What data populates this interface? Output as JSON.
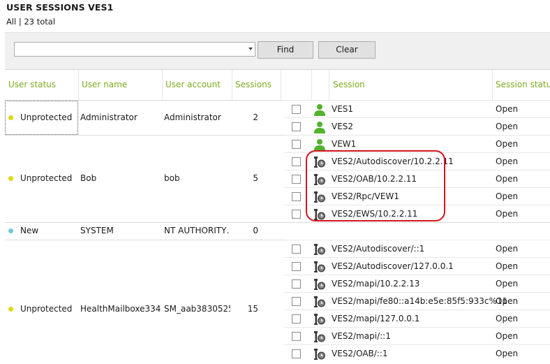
{
  "header": {
    "title": "USER SESSIONS  VES1",
    "subtitle": "All | 23 total"
  },
  "filter": {
    "value": "",
    "placeholder": "",
    "find_label": "Find",
    "clear_label": "Clear"
  },
  "columns": {
    "user_status": "User status",
    "user_name": "User name",
    "user_account": "User account",
    "sessions": "Sessions",
    "session": "Session",
    "session_status": "Session status"
  },
  "colors": {
    "header_green": "#7cab1f",
    "unprotected": "#e0d90f",
    "new": "#6ecbd3",
    "highlight": "#d4141f"
  },
  "users": [
    {
      "status": "Unprotected",
      "status_color": "#e0d90f",
      "name": "Administrator",
      "account": "Administrator",
      "sessions": "2"
    },
    {
      "status": "Unprotected",
      "status_color": "#e0d90f",
      "name": "Bob",
      "account": "bob",
      "sessions": "5"
    },
    {
      "status": "New",
      "status_color": "#6ecbd3",
      "name": "SYSTEM",
      "account": "NT AUTHORITY…",
      "sessions": "0"
    },
    {
      "status": "Unprotected",
      "status_color": "#e0d90f",
      "name": "HealthMailboxe334…",
      "account": "SM_aab3830525…",
      "sessions": "15"
    }
  ],
  "sessions": [
    {
      "icon": "user-icon",
      "name": "VES1",
      "status": "Open"
    },
    {
      "icon": "user-icon",
      "name": "VES2",
      "status": "Open"
    },
    {
      "icon": "user-icon",
      "name": "VEW1",
      "status": "Open"
    },
    {
      "icon": "service-icon",
      "name": "VES2/Autodiscover/10.2.2.11",
      "status": "Open"
    },
    {
      "icon": "service-icon",
      "name": "VES2/OAB/10.2.2.11",
      "status": "Open"
    },
    {
      "icon": "service-icon",
      "name": "VES2/Rpc/VEW1",
      "status": "Open"
    },
    {
      "icon": "service-icon",
      "name": "VES2/EWS/10.2.2.11",
      "status": "Open"
    },
    {
      "icon": "service-icon",
      "name": "VES2/Autodiscover/::1",
      "status": "Open"
    },
    {
      "icon": "service-icon",
      "name": "VES2/Autodiscover/127.0.0.1",
      "status": "Open"
    },
    {
      "icon": "service-icon",
      "name": "VES2/mapi/10.2.2.13",
      "status": "Open"
    },
    {
      "icon": "service-icon",
      "name": "VES2/mapi/fe80::a14b:e5e:85f5:933c%11",
      "status": "Open"
    },
    {
      "icon": "service-icon",
      "name": "VES2/mapi/127.0.0.1",
      "status": "Open"
    },
    {
      "icon": "service-icon",
      "name": "VES2/mapi/::1",
      "status": "Open"
    },
    {
      "icon": "service-icon",
      "name": "VES2/OAB/::1",
      "status": "Open"
    }
  ]
}
